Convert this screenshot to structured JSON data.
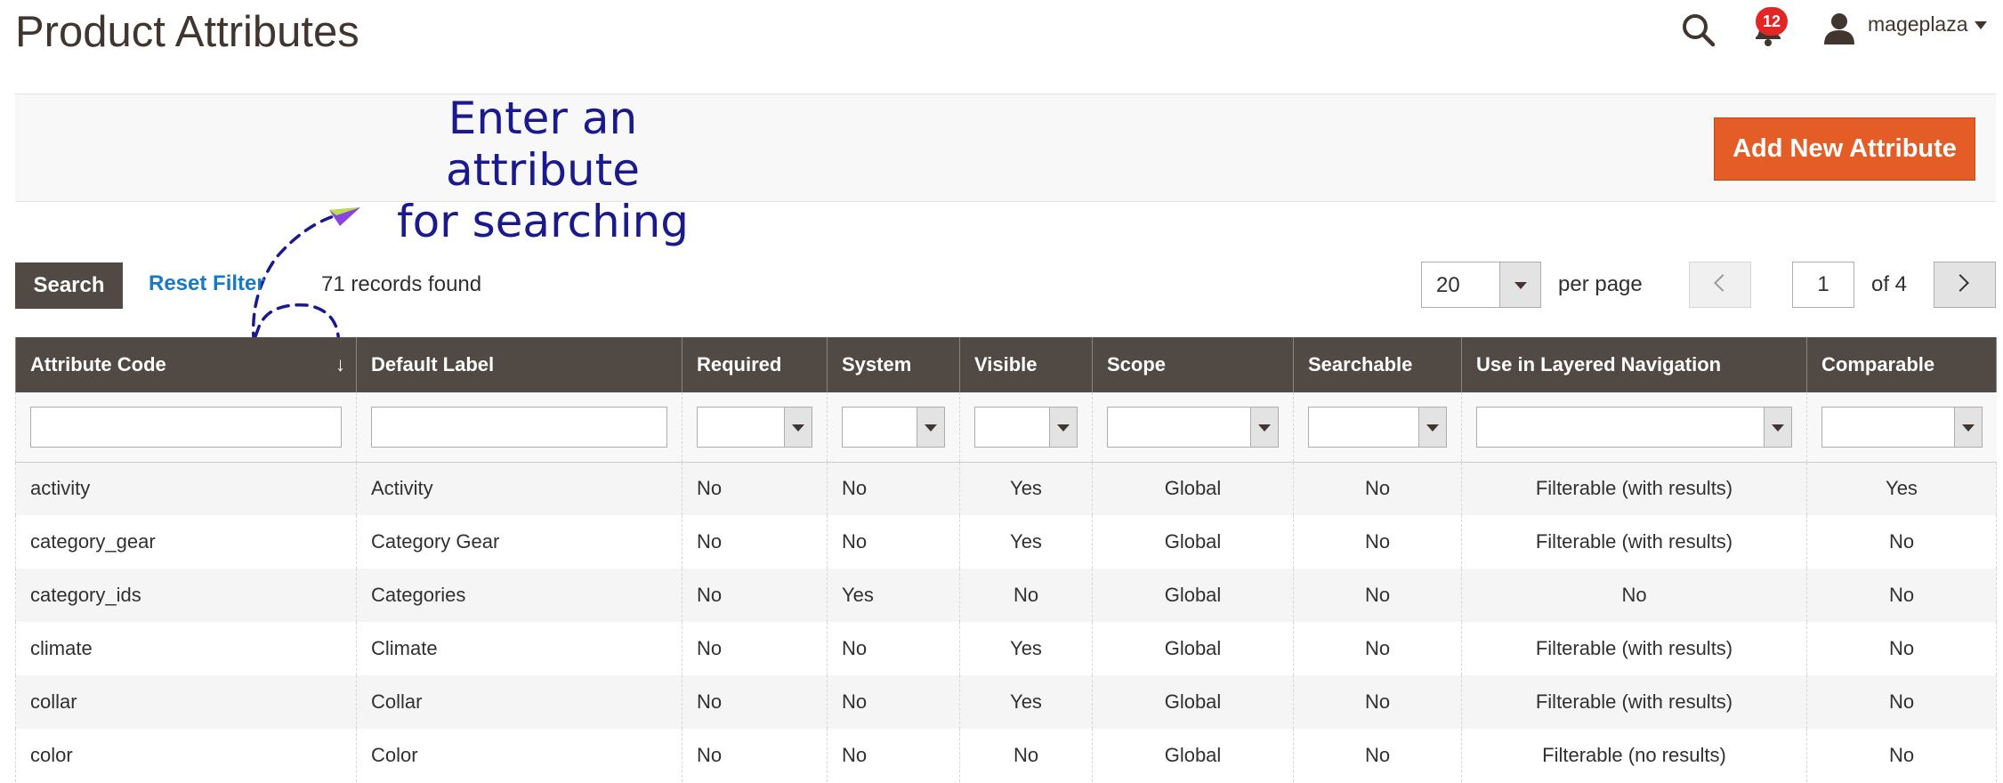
{
  "header": {
    "title": "Product Attributes",
    "notification_count": "12",
    "user_name": "mageplaza",
    "icons": [
      "search-icon",
      "bell-icon",
      "user-icon",
      "chevron-down-icon"
    ]
  },
  "action_bar": {
    "add_button_label": "Add New Attribute",
    "annotation_line1": "Enter an attribute",
    "annotation_line2": "for searching"
  },
  "toolbar": {
    "search_label": "Search",
    "reset_label": "Reset Filter",
    "records_text": "71 records found",
    "per_page_value": "20",
    "per_page_label": "per page",
    "current_page": "1",
    "page_of": "of 4"
  },
  "colors": {
    "accent": "#e45d27",
    "header_bg": "#514943",
    "link": "#1979c3",
    "annotation": "#1a1a8c"
  },
  "table": {
    "columns": [
      "Attribute Code",
      "Default Label",
      "Required",
      "System",
      "Visible",
      "Scope",
      "Searchable",
      "Use in Layered Navigation",
      "Comparable"
    ],
    "rows": [
      [
        "activity",
        "Activity",
        "No",
        "No",
        "Yes",
        "Global",
        "No",
        "Filterable (with results)",
        "Yes"
      ],
      [
        "category_gear",
        "Category Gear",
        "No",
        "No",
        "Yes",
        "Global",
        "No",
        "Filterable (with results)",
        "No"
      ],
      [
        "category_ids",
        "Categories",
        "No",
        "Yes",
        "No",
        "Global",
        "No",
        "No",
        "No"
      ],
      [
        "climate",
        "Climate",
        "No",
        "No",
        "Yes",
        "Global",
        "No",
        "Filterable (with results)",
        "No"
      ],
      [
        "collar",
        "Collar",
        "No",
        "No",
        "Yes",
        "Global",
        "No",
        "Filterable (with results)",
        "No"
      ],
      [
        "color",
        "Color",
        "No",
        "No",
        "No",
        "Global",
        "No",
        "Filterable (no results)",
        "No"
      ]
    ]
  }
}
